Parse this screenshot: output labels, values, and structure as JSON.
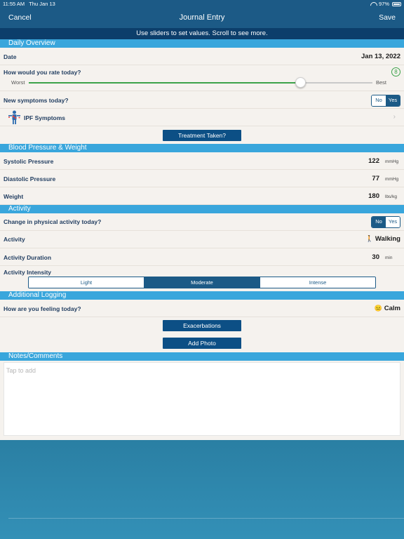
{
  "status_bar": {
    "time": "11:55 AM",
    "date": "Thu Jan 13",
    "battery": "97%"
  },
  "nav": {
    "cancel": "Cancel",
    "title": "Journal Entry",
    "save": "Save"
  },
  "hint": "Use sliders to set values. Scroll to see more.",
  "daily_overview": {
    "header": "Daily Overview",
    "date_label": "Date",
    "date_value": "Jan 13, 2022",
    "rating_label": "How would you rate today?",
    "rating_value": "8",
    "rating_fraction": 0.79,
    "slider_min_label": "Worst",
    "slider_max_label": "Best",
    "symptoms_label": "New symptoms today?",
    "symptoms_no": "No",
    "symptoms_yes": "Yes",
    "symptoms_selected": "Yes",
    "ipf_label": "IPF Symptoms",
    "treatment_button": "Treatment Taken?"
  },
  "blood_pressure": {
    "header": "Blood Pressure & Weight",
    "systolic_label": "Systolic Pressure",
    "systolic_value": "122",
    "systolic_unit": "mmHg",
    "diastolic_label": "Diastolic Pressure",
    "diastolic_value": "77",
    "diastolic_unit": "mmHg",
    "weight_label": "Weight",
    "weight_value": "180",
    "weight_unit": "lbs/kg"
  },
  "activity": {
    "header": "Activity",
    "change_label": "Change in physical activity today?",
    "change_no": "No",
    "change_yes": "Yes",
    "change_selected": "No",
    "activity_label": "Activity",
    "activity_value": "Walking",
    "activity_icon": "🚶",
    "duration_label": "Activity Duration",
    "duration_value": "30",
    "duration_unit": "min",
    "intensity_label": "Activity Intensity",
    "intensity_options": [
      "Light",
      "Moderate",
      "Intense"
    ],
    "intensity_selected": "Moderate"
  },
  "additional": {
    "header": "Additional Logging",
    "feeling_label": "How are you feeling today?",
    "feeling_icon": "😐",
    "feeling_value": "Calm",
    "exacerbations_button": "Exacerbations",
    "photo_button": "Add Photo"
  },
  "notes": {
    "header": "Notes/Comments",
    "placeholder": "Tap to add"
  },
  "colors": {
    "nav": "#1c5a86",
    "section": "#39a6dc",
    "accent_green": "#3ca24a",
    "button": "#0c4f85"
  }
}
